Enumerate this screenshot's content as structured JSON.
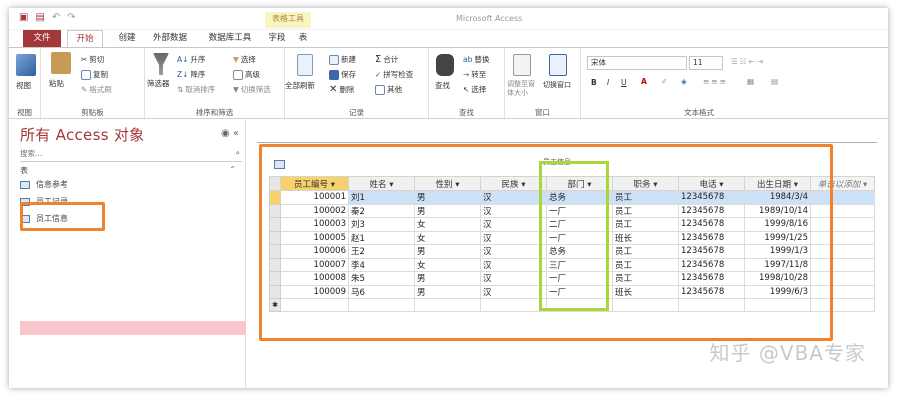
{
  "window": {
    "title": "Microsoft Access",
    "context_tab": "表格工具"
  },
  "tabs": [
    "文件",
    "开始",
    "创建",
    "外部数据",
    "数据库工具",
    "字段",
    "表"
  ],
  "ribbon": {
    "groups": [
      "视图",
      "剪贴板",
      "排序和筛选",
      "记录",
      "查找",
      "窗口",
      "文本格式"
    ],
    "view": {
      "label": "视图"
    },
    "clipboard": {
      "paste": "粘贴",
      "cut": "剪切",
      "copy": "复制",
      "format_painter": "格式刷"
    },
    "sort_filter": {
      "filter": "筛选器",
      "asc": "升序",
      "desc": "降序",
      "remove_sort": "取消排序",
      "selection": "选择",
      "advanced": "高级",
      "toggle_filter": "切换筛选"
    },
    "records": {
      "refresh_all": "全部刷新",
      "new": "新建",
      "save": "保存",
      "delete": "删除",
      "totals": "合计",
      "spelling": "拼写检查",
      "more": "其他"
    },
    "find": {
      "find": "查找",
      "replace": "替换",
      "goto": "转至",
      "select": "选择"
    },
    "window": {
      "fit": "调整至窗体大小",
      "switch": "切换窗口"
    },
    "text": {
      "font": "宋体",
      "size": "11",
      "bold": "B",
      "italic": "I",
      "underline": "U"
    }
  },
  "nav": {
    "title": "所有 Access 对象",
    "search_placeholder": "搜索...",
    "group": "表",
    "items": [
      "信息参考",
      "员工记录",
      "员工信息"
    ]
  },
  "document": {
    "tab_title": "员工信息"
  },
  "table": {
    "headers": [
      "员工编号",
      "姓名",
      "性别",
      "民族",
      "部门",
      "职务",
      "电话",
      "出生日期",
      "单击以添加"
    ],
    "rows": [
      [
        "100001",
        "刘1",
        "男",
        "汉",
        "总务",
        "员工",
        "12345678",
        "1984/3/4"
      ],
      [
        "100002",
        "秦2",
        "男",
        "汉",
        "一厂",
        "员工",
        "12345678",
        "1989/10/14"
      ],
      [
        "100003",
        "刘3",
        "女",
        "汉",
        "二厂",
        "员工",
        "12345678",
        "1999/8/16"
      ],
      [
        "100005",
        "赵1",
        "女",
        "汉",
        "一厂",
        "班长",
        "12345678",
        "1999/1/25"
      ],
      [
        "100006",
        "王2",
        "男",
        "汉",
        "总务",
        "员工",
        "12345678",
        "1999/1/3"
      ],
      [
        "100007",
        "李4",
        "女",
        "汉",
        "三厂",
        "员工",
        "12345678",
        "1997/11/8"
      ],
      [
        "100008",
        "朱5",
        "男",
        "汉",
        "一厂",
        "员工",
        "12345678",
        "1998/10/28"
      ],
      [
        "100009",
        "马6",
        "男",
        "汉",
        "一厂",
        "班长",
        "12345678",
        "1999/6/3"
      ]
    ]
  },
  "watermark": "知乎 @VBA专家",
  "colors": {
    "accent": "#a4373a",
    "highlight_orange": "#f0822d",
    "highlight_green": "#a8d63b"
  }
}
